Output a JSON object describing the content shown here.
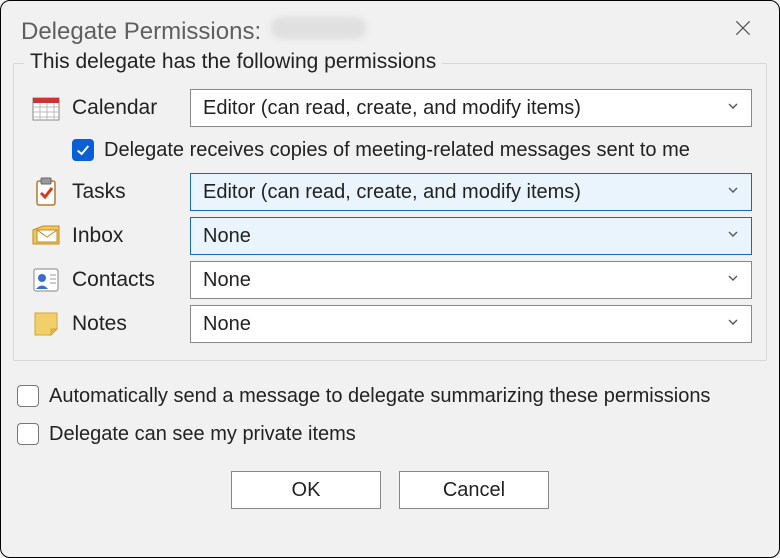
{
  "title_prefix": "Delegate Permissions:",
  "group_title": "This delegate has the following permissions",
  "rows": {
    "calendar": {
      "label": "Calendar",
      "value": "Editor (can read, create, and modify items)"
    },
    "tasks": {
      "label": "Tasks",
      "value": "Editor (can read, create, and modify items)"
    },
    "inbox": {
      "label": "Inbox",
      "value": "None"
    },
    "contacts": {
      "label": "Contacts",
      "value": "None"
    },
    "notes": {
      "label": "Notes",
      "value": "None"
    }
  },
  "meeting_copies": {
    "label": "Delegate receives copies of meeting-related messages sent to me",
    "checked": true
  },
  "auto_send": {
    "label": "Automatically send a message to delegate summarizing these permissions",
    "checked": false
  },
  "private_items": {
    "label": "Delegate can see my private items",
    "checked": false
  },
  "buttons": {
    "ok": "OK",
    "cancel": "Cancel"
  }
}
